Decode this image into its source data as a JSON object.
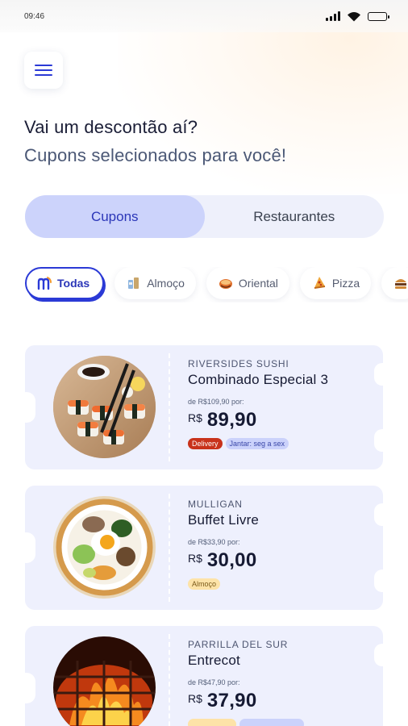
{
  "status_bar": {
    "time": "09:46"
  },
  "header": {
    "menu_icon": "hamburger-menu-icon",
    "title": "Vai um descontão aí?",
    "subtitle": "Cupons selecionados para você!"
  },
  "segmented": {
    "tabs": [
      {
        "label": "Cupons",
        "active": true
      },
      {
        "label": "Restaurantes",
        "active": false
      }
    ]
  },
  "filters": [
    {
      "label": "Todas",
      "icon": "brand-m-icon",
      "active": true
    },
    {
      "label": "Almoço",
      "icon": "lunch-icon",
      "active": false
    },
    {
      "label": "Oriental",
      "icon": "oriental-icon",
      "active": false
    },
    {
      "label": "Pizza",
      "icon": "pizza-icon",
      "active": false
    },
    {
      "label": "",
      "icon": "burger-icon",
      "active": false
    }
  ],
  "coupons": [
    {
      "restaurant": "RIVERSIDES SUSHI",
      "dish": "Combinado Especial 3",
      "old_price": "de R$109,90 por:",
      "currency": "R$",
      "price": "89,90",
      "tags": [
        {
          "label": "Delivery",
          "color": "#c8321b"
        },
        {
          "label": "Jantar: seg a sex",
          "color": "#cbd2fb"
        }
      ],
      "photo": "sushi-photo"
    },
    {
      "restaurant": "MULLIGAN",
      "dish": "Buffet Livre",
      "old_price": "de R$33,90 por:",
      "currency": "R$",
      "price": "30,00",
      "tags": [
        {
          "label": "Almoço",
          "color": "#fde3a8"
        }
      ],
      "photo": "salad-bowl-photo"
    },
    {
      "restaurant": "PARRILLA DEL SUR",
      "dish": "Entrecot",
      "old_price": "de R$47,90 por:",
      "currency": "R$",
      "price": "37,90",
      "tags": [],
      "photo": "grill-fire-photo"
    }
  ],
  "colors": {
    "accent": "#2b3ad6",
    "segment_active": "#ccd3fb",
    "card_bg": "#eef0fd",
    "delivery_tag": "#c8321b"
  }
}
